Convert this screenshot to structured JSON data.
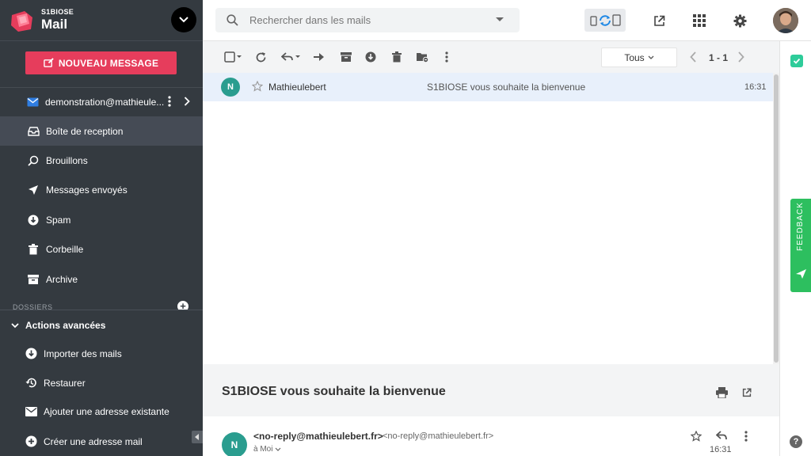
{
  "app": {
    "brand_small": "S1BIOSE",
    "brand_big": "Mail",
    "accent": "#e63d5c",
    "sidebar_bg": "#343a40"
  },
  "sidebar": {
    "new_message_label": "NOUVEAU MESSAGE",
    "account_label": "demonstration@mathieule...",
    "items": [
      {
        "label": "Boîte de reception",
        "icon": "inbox-icon",
        "active": true
      },
      {
        "label": "Brouillons",
        "icon": "draft-icon"
      },
      {
        "label": "Messages envoyés",
        "icon": "send-icon"
      },
      {
        "label": "Spam",
        "icon": "spam-icon"
      },
      {
        "label": "Corbeille",
        "icon": "trash-icon"
      },
      {
        "label": "Archive",
        "icon": "archive-icon"
      }
    ],
    "folders_title": "DOSSIERS",
    "advanced_title": "Actions avancées",
    "advanced_items": [
      {
        "label": "Importer des mails",
        "icon": "import-icon"
      },
      {
        "label": "Restaurer",
        "icon": "restore-icon"
      },
      {
        "label": "Ajouter une adresse existante",
        "icon": "mail-add-icon"
      },
      {
        "label": "Créer une adresse mail",
        "icon": "plus-circle-icon"
      }
    ]
  },
  "search": {
    "placeholder": "Rechercher dans les mails"
  },
  "toolbar": {
    "filter_label": "Tous",
    "pager": "1 - 1"
  },
  "mail_list": [
    {
      "avatar": "N",
      "sender": "Mathieulebert",
      "subject": "S1BIOSE vous souhaite la bienvenue",
      "time": "16:31"
    }
  ],
  "reader": {
    "subject": "S1BIOSE vous souhaite la bienvenue",
    "avatar": "N",
    "from_name": "<no-reply@mathieulebert.fr>",
    "from_addr": "<no-reply@mathieulebert.fr>",
    "to": "à Moi",
    "time": "16:31"
  },
  "rail": {
    "feedback_label": "FEEDBACK",
    "help_label": "?",
    "feedback_color": "#2dbf5f"
  }
}
